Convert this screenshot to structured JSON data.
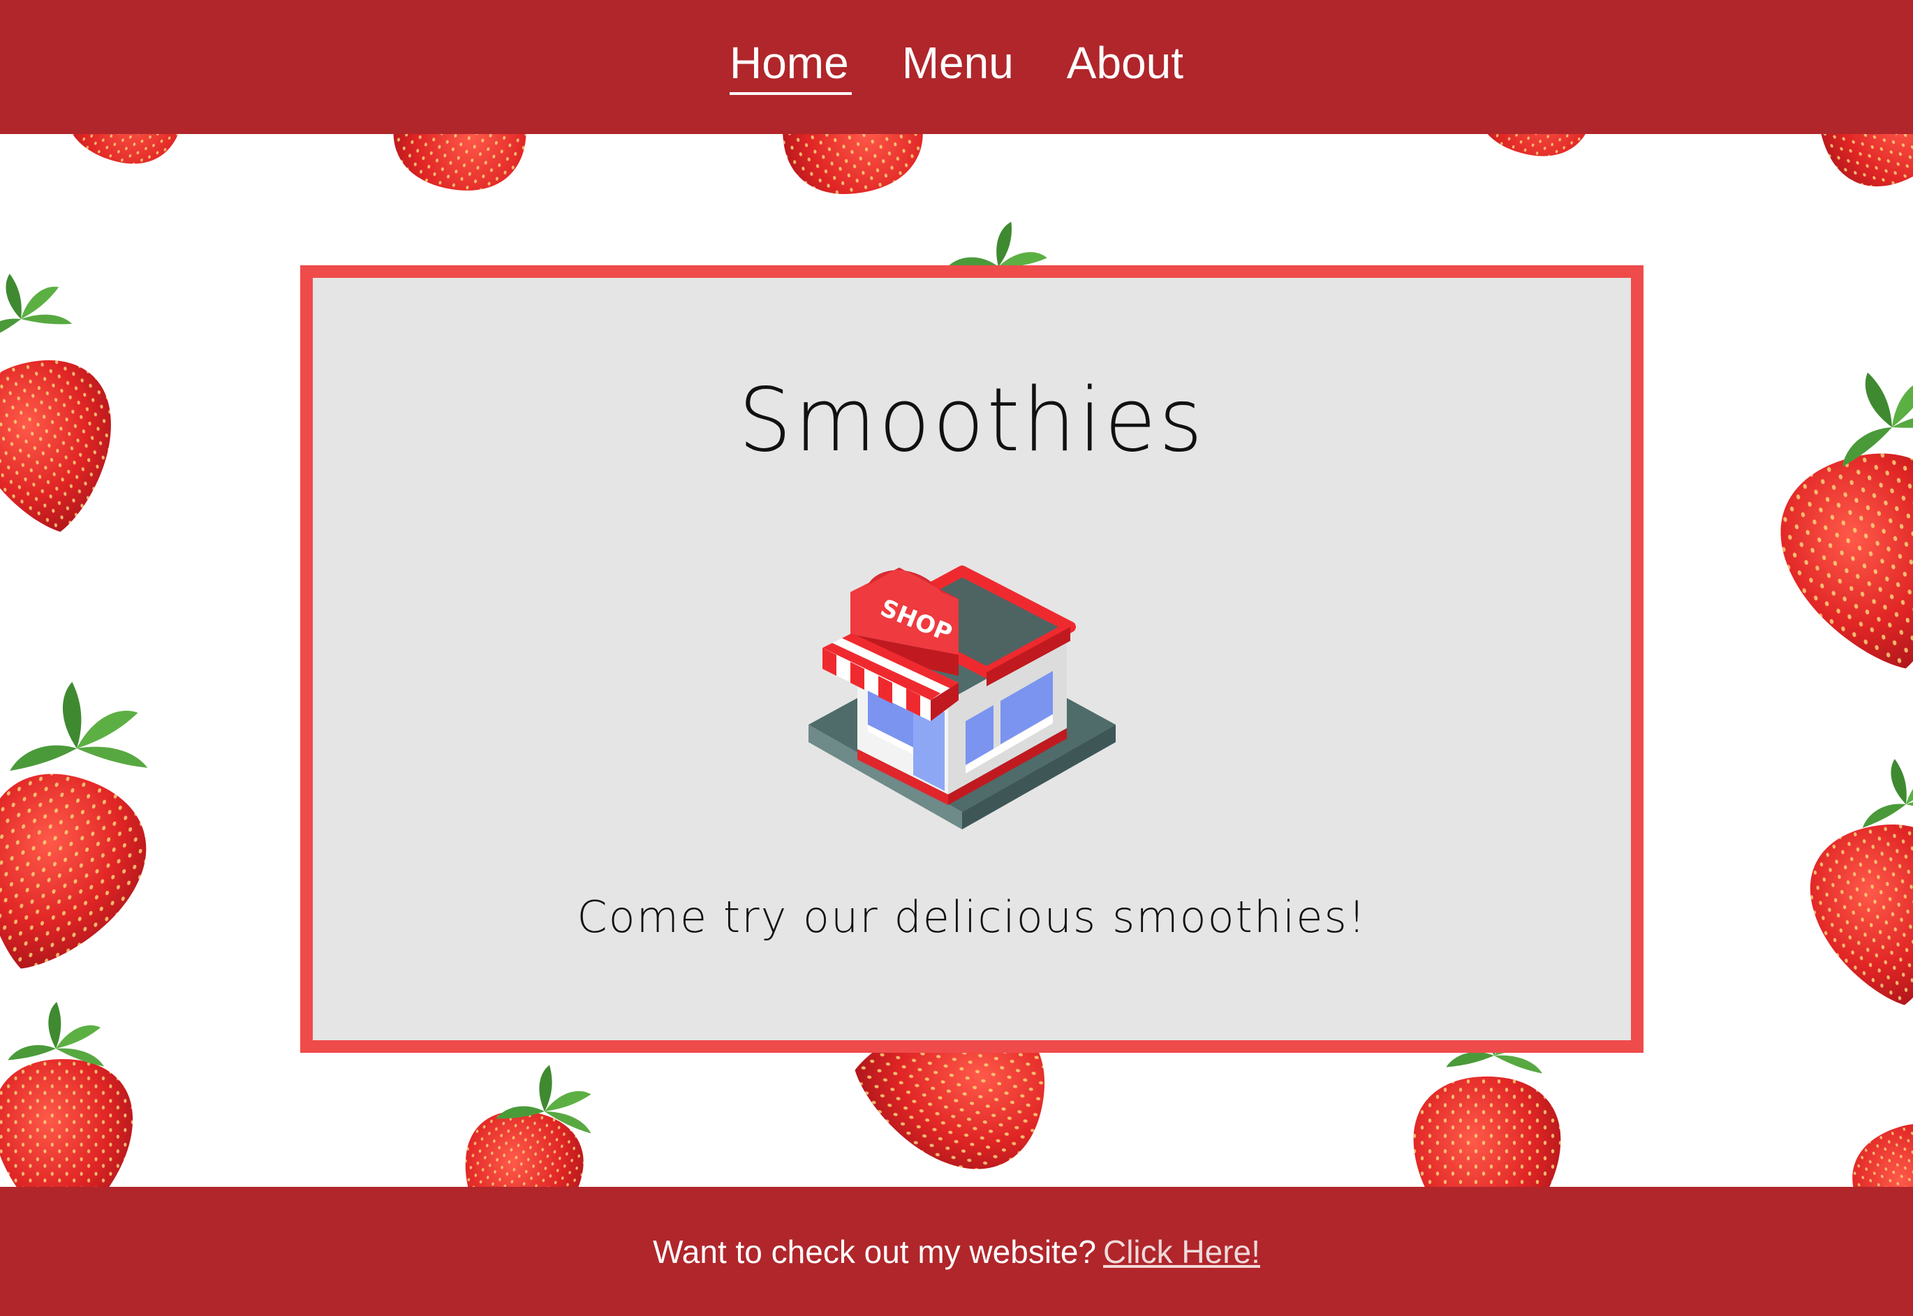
{
  "nav": {
    "items": [
      {
        "label": "Home",
        "active": true
      },
      {
        "label": "Menu",
        "active": false
      },
      {
        "label": "About",
        "active": false
      }
    ]
  },
  "hero": {
    "title": "Smoothies",
    "illustration_label": "SHOP",
    "illustration_icon": "shop-storefront-icon",
    "tagline": "Come try our delicious smoothies!"
  },
  "footer": {
    "text": "Want to check out my website?",
    "link_label": "Click Here!"
  },
  "colors": {
    "brand_red": "#b0262b",
    "card_border": "#ef4b4b",
    "card_background": "#e5e5e5",
    "strawberry_red": "#e02525",
    "leaf_green": "#4a9a3a"
  },
  "background": {
    "pattern": "strawberry-pattern"
  }
}
